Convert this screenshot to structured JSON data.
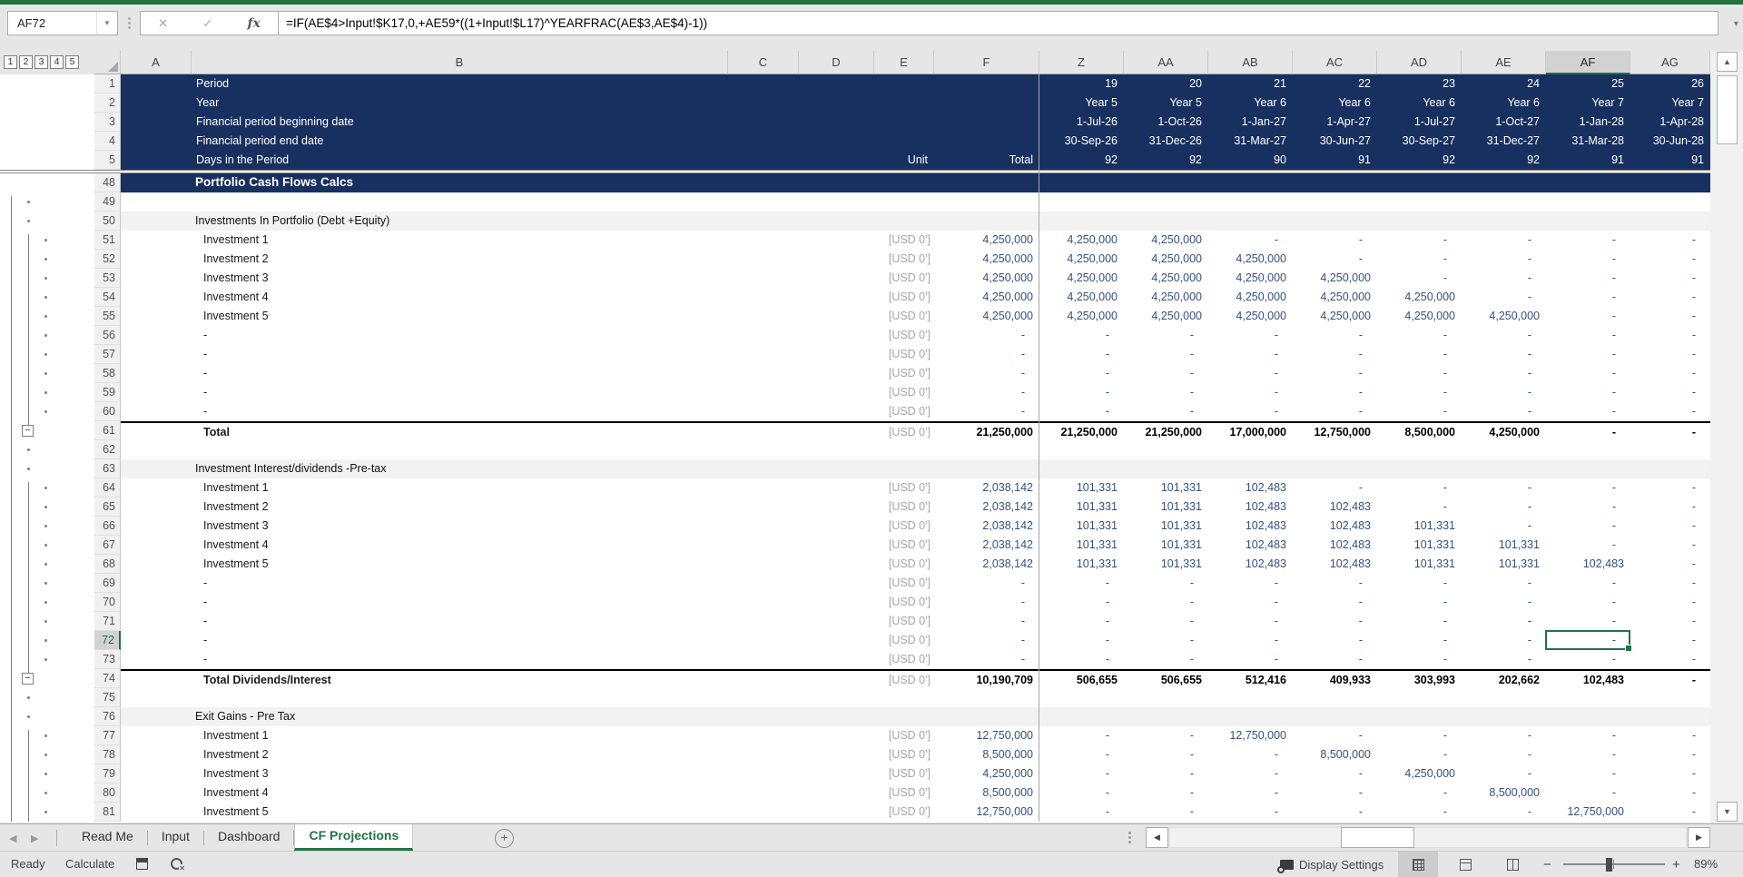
{
  "chrome": {
    "name_box": "AF72",
    "name_box_dropdown": "▾",
    "formula": "=IF(AE$4>Input!$K17,0,+AE59*((1+Input!$L17)^YEARFRAC(AE$3,AE$4)-1))",
    "formula_buttons": {
      "cancel": "✕",
      "enter": "✓",
      "insert_function": "fx"
    },
    "expand_formula_bar": "▾",
    "outline_level_buttons": [
      "1",
      "2",
      "3",
      "4",
      "5"
    ]
  },
  "grid": {
    "left_columns": [
      "A",
      "B",
      "C",
      "D",
      "E",
      "F"
    ],
    "period_columns": [
      "Z",
      "AA",
      "AB",
      "AC",
      "AD",
      "AE",
      "AF",
      "AG"
    ],
    "selected": {
      "cell": "AF72",
      "column": "AF",
      "row": "72"
    },
    "frozen_rows": [
      {
        "num": "1",
        "label": "Period",
        "unit": "",
        "total": "",
        "values": [
          "19",
          "20",
          "21",
          "22",
          "23",
          "24",
          "25",
          "26"
        ]
      },
      {
        "num": "2",
        "label": "Year",
        "unit": "",
        "total": "",
        "values": [
          "Year 5",
          "Year 5",
          "Year 6",
          "Year 6",
          "Year 6",
          "Year 6",
          "Year 7",
          "Year 7"
        ]
      },
      {
        "num": "3",
        "label": "Financial period beginning date",
        "unit": "",
        "total": "",
        "values": [
          "1-Jul-26",
          "1-Oct-26",
          "1-Jan-27",
          "1-Apr-27",
          "1-Jul-27",
          "1-Oct-27",
          "1-Jan-28",
          "1-Apr-28"
        ]
      },
      {
        "num": "4",
        "label": "Financial period end date",
        "unit": "",
        "total": "",
        "values": [
          "30-Sep-26",
          "31-Dec-26",
          "31-Mar-27",
          "30-Jun-27",
          "30-Sep-27",
          "31-Dec-27",
          "31-Mar-28",
          "30-Jun-28"
        ]
      },
      {
        "num": "5",
        "label": "Days in the Period",
        "unit": "Unit",
        "total": "Total",
        "values": [
          "92",
          "92",
          "90",
          "91",
          "92",
          "92",
          "91",
          "91"
        ]
      }
    ],
    "body_rows": [
      {
        "num": "48",
        "type": "section",
        "label": "Portfolio Cash Flows Calcs",
        "outline": "none"
      },
      {
        "num": "49",
        "type": "blank",
        "outline": "dot-outer"
      },
      {
        "num": "50",
        "type": "band",
        "label": "Investments In Portfolio (Debt +Equity)",
        "outline": "dot-outer"
      },
      {
        "num": "51",
        "type": "data",
        "label": "Investment 1",
        "unit": "[USD 0']",
        "total": "4,250,000",
        "values": [
          "4,250,000",
          "4,250,000",
          "-",
          "-",
          "-",
          "-",
          "-",
          "-"
        ],
        "outline": "dot"
      },
      {
        "num": "52",
        "type": "data",
        "label": "Investment 2",
        "unit": "[USD 0']",
        "total": "4,250,000",
        "values": [
          "4,250,000",
          "4,250,000",
          "4,250,000",
          "-",
          "-",
          "-",
          "-",
          "-"
        ],
        "outline": "dot"
      },
      {
        "num": "53",
        "type": "data",
        "label": "Investment 3",
        "unit": "[USD 0']",
        "total": "4,250,000",
        "values": [
          "4,250,000",
          "4,250,000",
          "4,250,000",
          "4,250,000",
          "-",
          "-",
          "-",
          "-"
        ],
        "outline": "dot"
      },
      {
        "num": "54",
        "type": "data",
        "label": "Investment 4",
        "unit": "[USD 0']",
        "total": "4,250,000",
        "values": [
          "4,250,000",
          "4,250,000",
          "4,250,000",
          "4,250,000",
          "4,250,000",
          "-",
          "-",
          "-"
        ],
        "outline": "dot"
      },
      {
        "num": "55",
        "type": "data",
        "label": "Investment 5",
        "unit": "[USD 0']",
        "total": "4,250,000",
        "values": [
          "4,250,000",
          "4,250,000",
          "4,250,000",
          "4,250,000",
          "4,250,000",
          "4,250,000",
          "-",
          "-"
        ],
        "outline": "dot"
      },
      {
        "num": "56",
        "type": "data",
        "label": "-",
        "unit": "[USD 0']",
        "total": "-",
        "values": [
          "-",
          "-",
          "-",
          "-",
          "-",
          "-",
          "-",
          "-"
        ],
        "outline": "dot"
      },
      {
        "num": "57",
        "type": "data",
        "label": "-",
        "unit": "[USD 0']",
        "total": "-",
        "values": [
          "-",
          "-",
          "-",
          "-",
          "-",
          "-",
          "-",
          "-"
        ],
        "outline": "dot"
      },
      {
        "num": "58",
        "type": "data",
        "label": "-",
        "unit": "[USD 0']",
        "total": "-",
        "values": [
          "-",
          "-",
          "-",
          "-",
          "-",
          "-",
          "-",
          "-"
        ],
        "outline": "dot"
      },
      {
        "num": "59",
        "type": "data",
        "label": "-",
        "unit": "[USD 0']",
        "total": "-",
        "values": [
          "-",
          "-",
          "-",
          "-",
          "-",
          "-",
          "-",
          "-"
        ],
        "outline": "dot"
      },
      {
        "num": "60",
        "type": "data",
        "label": "-",
        "unit": "[USD 0']",
        "total": "-",
        "values": [
          "-",
          "-",
          "-",
          "-",
          "-",
          "-",
          "-",
          "-"
        ],
        "outline": "dot"
      },
      {
        "num": "61",
        "type": "total",
        "label": "Total",
        "unit": "[USD 0']",
        "total": "21,250,000",
        "values": [
          "21,250,000",
          "21,250,000",
          "17,000,000",
          "12,750,000",
          "8,500,000",
          "4,250,000",
          "-",
          "-"
        ],
        "outline": "minus"
      },
      {
        "num": "62",
        "type": "blank",
        "outline": "dot-outer"
      },
      {
        "num": "63",
        "type": "band",
        "label": "Investment Interest/dividends -Pre-tax",
        "outline": "dot-outer"
      },
      {
        "num": "64",
        "type": "data",
        "label": "Investment 1",
        "unit": "[USD 0']",
        "total": "2,038,142",
        "values": [
          "101,331",
          "101,331",
          "102,483",
          "-",
          "-",
          "-",
          "-",
          "-"
        ],
        "outline": "dot"
      },
      {
        "num": "65",
        "type": "data",
        "label": "Investment 2",
        "unit": "[USD 0']",
        "total": "2,038,142",
        "values": [
          "101,331",
          "101,331",
          "102,483",
          "102,483",
          "-",
          "-",
          "-",
          "-"
        ],
        "outline": "dot"
      },
      {
        "num": "66",
        "type": "data",
        "label": "Investment 3",
        "unit": "[USD 0']",
        "total": "2,038,142",
        "values": [
          "101,331",
          "101,331",
          "102,483",
          "102,483",
          "101,331",
          "-",
          "-",
          "-"
        ],
        "outline": "dot"
      },
      {
        "num": "67",
        "type": "data",
        "label": "Investment 4",
        "unit": "[USD 0']",
        "total": "2,038,142",
        "values": [
          "101,331",
          "101,331",
          "102,483",
          "102,483",
          "101,331",
          "101,331",
          "-",
          "-"
        ],
        "outline": "dot"
      },
      {
        "num": "68",
        "type": "data",
        "label": "Investment 5",
        "unit": "[USD 0']",
        "total": "2,038,142",
        "values": [
          "101,331",
          "101,331",
          "102,483",
          "102,483",
          "101,331",
          "101,331",
          "102,483",
          "-"
        ],
        "outline": "dot"
      },
      {
        "num": "69",
        "type": "data",
        "label": "-",
        "unit": "[USD 0']",
        "total": "-",
        "values": [
          "-",
          "-",
          "-",
          "-",
          "-",
          "-",
          "-",
          "-"
        ],
        "outline": "dot"
      },
      {
        "num": "70",
        "type": "data",
        "label": "-",
        "unit": "[USD 0']",
        "total": "-",
        "values": [
          "-",
          "-",
          "-",
          "-",
          "-",
          "-",
          "-",
          "-"
        ],
        "outline": "dot"
      },
      {
        "num": "71",
        "type": "data",
        "label": "-",
        "unit": "[USD 0']",
        "total": "-",
        "values": [
          "-",
          "-",
          "-",
          "-",
          "-",
          "-",
          "-",
          "-"
        ],
        "outline": "dot"
      },
      {
        "num": "72",
        "type": "data",
        "label": "-",
        "unit": "[USD 0']",
        "total": "-",
        "values": [
          "-",
          "-",
          "-",
          "-",
          "-",
          "-",
          "-",
          "-"
        ],
        "outline": "dot"
      },
      {
        "num": "73",
        "type": "data",
        "label": "-",
        "unit": "[USD 0']",
        "total": "-",
        "values": [
          "-",
          "-",
          "-",
          "-",
          "-",
          "-",
          "-",
          "-"
        ],
        "outline": "dot"
      },
      {
        "num": "74",
        "type": "total",
        "label": "Total Dividends/Interest",
        "unit": "[USD 0']",
        "total": "10,190,709",
        "values": [
          "506,655",
          "506,655",
          "512,416",
          "409,933",
          "303,993",
          "202,662",
          "102,483",
          "-"
        ],
        "outline": "minus"
      },
      {
        "num": "75",
        "type": "blank",
        "outline": "dot-outer"
      },
      {
        "num": "76",
        "type": "band",
        "label": "Exit Gains - Pre Tax",
        "outline": "dot-outer"
      },
      {
        "num": "77",
        "type": "data",
        "label": "Investment 1",
        "unit": "[USD 0']",
        "total": "12,750,000",
        "values": [
          "-",
          "-",
          "12,750,000",
          "-",
          "-",
          "-",
          "-",
          "-"
        ],
        "outline": "dot"
      },
      {
        "num": "78",
        "type": "data",
        "label": "Investment 2",
        "unit": "[USD 0']",
        "total": "8,500,000",
        "values": [
          "-",
          "-",
          "-",
          "8,500,000",
          "-",
          "-",
          "-",
          "-"
        ],
        "outline": "dot"
      },
      {
        "num": "79",
        "type": "data",
        "label": "Investment 3",
        "unit": "[USD 0']",
        "total": "4,250,000",
        "values": [
          "-",
          "-",
          "-",
          "-",
          "4,250,000",
          "-",
          "-",
          "-"
        ],
        "outline": "dot"
      },
      {
        "num": "80",
        "type": "data",
        "label": "Investment 4",
        "unit": "[USD 0']",
        "total": "8,500,000",
        "values": [
          "-",
          "-",
          "-",
          "-",
          "-",
          "8,500,000",
          "-",
          "-"
        ],
        "outline": "dot"
      },
      {
        "num": "81",
        "type": "data",
        "label": "Investment 5",
        "unit": "[USD 0']",
        "total": "12,750,000",
        "values": [
          "-",
          "-",
          "-",
          "-",
          "-",
          "-",
          "12,750,000",
          "-"
        ],
        "outline": "dot"
      }
    ]
  },
  "sheet_tabs": {
    "nav_left": "◀",
    "nav_right": "▶",
    "tabs": [
      {
        "label": "Read Me",
        "active": false
      },
      {
        "label": "Input",
        "active": false
      },
      {
        "label": "Dashboard",
        "active": false
      },
      {
        "label": "CF Projections",
        "active": true
      }
    ],
    "new_sheet": "+"
  },
  "scrollbars": {
    "up": "▲",
    "down": "▼",
    "left": "◀",
    "right": "▶"
  },
  "status_bar": {
    "ready": "Ready",
    "calculate": "Calculate",
    "display_settings": "Display Settings",
    "zoom_out": "−",
    "zoom_in": "+",
    "zoom_level": "89%"
  }
}
